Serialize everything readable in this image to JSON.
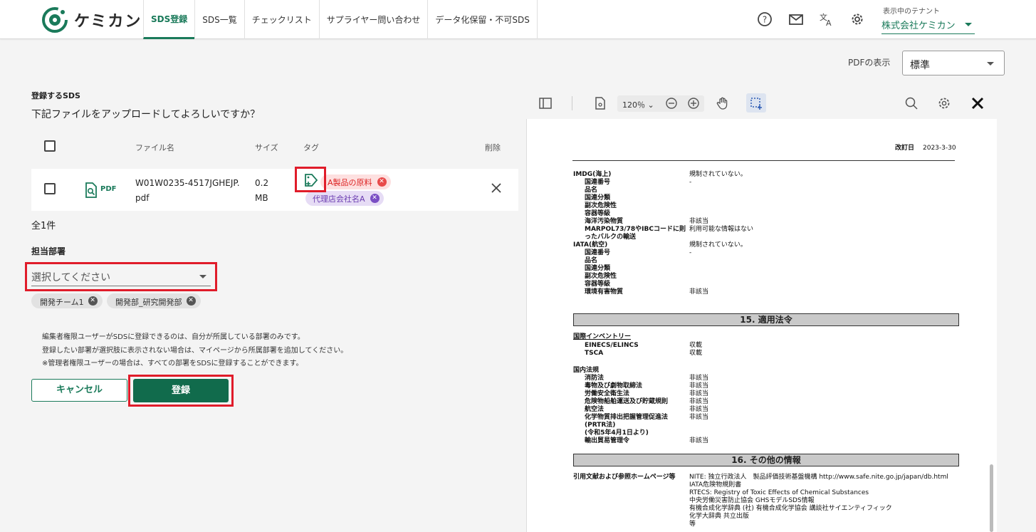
{
  "header": {
    "logo_text": "ケミカン",
    "nav": [
      "SDS登録",
      "SDS一覧",
      "チェックリスト",
      "サプライヤー問い合わせ",
      "データ化保留・不可SDS"
    ],
    "tenant_label": "表示中のテナント",
    "tenant_value": "株式会社ケミカン",
    "accent": "#1a7a5a"
  },
  "pdf_view": {
    "label": "PDFの表示",
    "value": "標準"
  },
  "form": {
    "section_title": "登録するSDS",
    "question": "下記ファイルをアップロードしてよろしいですか？",
    "columns": {
      "filename": "ファイル名",
      "size": "サイズ",
      "tag": "タグ",
      "delete": "削除"
    },
    "row": {
      "type": "PDF",
      "filename": "W01W0235-4517JGHEJP.pdf",
      "size": "0.2 MB",
      "tags": [
        "A製品の原料",
        "代理店会社名A"
      ]
    },
    "count": "全1件",
    "dept_title": "担当部署",
    "dept_placeholder": "選択してください",
    "dept_chips": [
      "開発チーム1",
      "開発部_研究開発部"
    ],
    "notes": [
      "編集者権限ユーザーがSDSに登録できるのは、自分が所属している部署のみです。",
      "登録したい部署が選択肢に表示されない場合は、マイページから所属部署を追加してください。",
      "※管理者権限ユーザーの場合は、すべての部署をSDSに登録することができます。"
    ],
    "cancel": "キャンセル",
    "register": "登録"
  },
  "viewer": {
    "zoom": "120％",
    "revised_label": "改訂日",
    "revised_date": "2023-3-30",
    "lines": [
      [
        "IMDG(海上)",
        "規制されていない。"
      ],
      [
        "国連番号",
        "-"
      ],
      [
        "品名",
        ""
      ],
      [
        "国連分類",
        ""
      ],
      [
        "副次危険性",
        ""
      ],
      [
        "容器等級",
        ""
      ],
      [
        "海洋汚染物質",
        "非該当"
      ],
      [
        "MARPOL73/78やIBCコードに則",
        "利用可能な情報はない"
      ],
      [
        "ったバルクの輸送",
        ""
      ],
      [
        "IATA(航空)",
        "規制されていない。"
      ],
      [
        "国連番号",
        "-"
      ],
      [
        "品名",
        ""
      ],
      [
        "国連分類",
        ""
      ],
      [
        "副次危険性",
        ""
      ],
      [
        "容器等級",
        ""
      ],
      [
        "環境有害物質",
        "非該当"
      ]
    ],
    "sec15": "15. 適用法令",
    "intl_title": "国際インベントリー",
    "intl": [
      [
        "EINECS/ELINCS",
        "収載"
      ],
      [
        "TSCA",
        "収載"
      ]
    ],
    "dom_title": "国内法規",
    "dom": [
      [
        "消防法",
        "非該当"
      ],
      [
        "毒物及び劇物取締法",
        "非該当"
      ],
      [
        "労働安全衛生法",
        "非該当"
      ],
      [
        "危険物船舶運送及び貯蔵規則",
        "非該当"
      ],
      [
        "航空法",
        "非該当"
      ],
      [
        "化学物質排出把握管理促進法",
        "非該当"
      ],
      [
        "(PRTR法)",
        ""
      ],
      [
        "(令和5年4月1日より)",
        ""
      ],
      [
        "輸出貿易管理令",
        "非該当"
      ]
    ],
    "sec16": "16. その他の情報",
    "ref_title": "引用文献および参照ホームページ等",
    "refs": [
      "NITE: 独立行政法人　製品評価技術基盤機構 http://www.safe.nite.go.jp/japan/db.html",
      "IATA危険物規則書",
      "RTECS: Registry of Toxic Effects of Chemical Substances",
      "中央労働災害防止協会 GHSモデルSDS情報",
      "有機合成化学辞典 (社) 有機合成化学協会 講談社サイエンティフィック",
      "化学大辞典 共立出版",
      "等"
    ]
  }
}
